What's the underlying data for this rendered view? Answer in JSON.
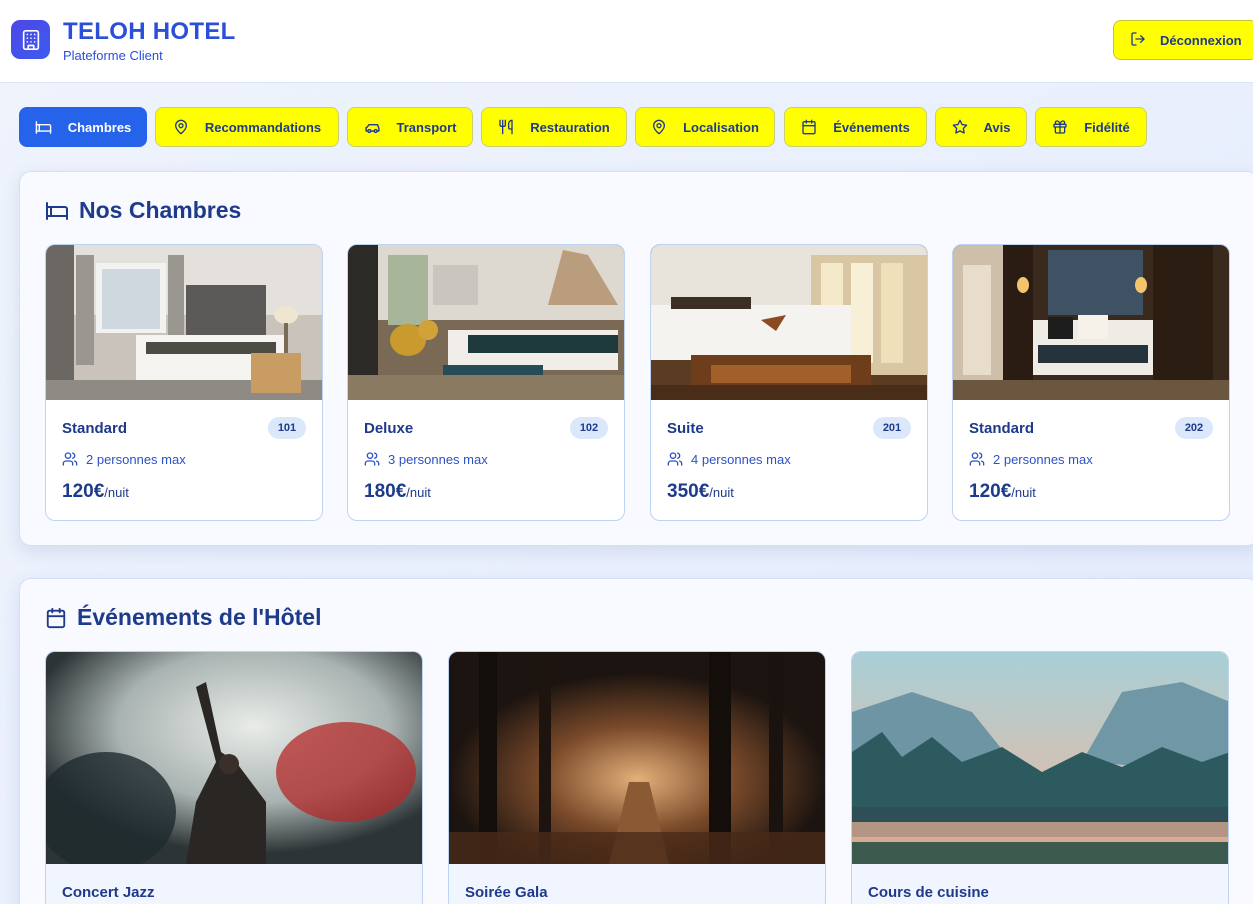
{
  "header": {
    "title": "TELOH HOTEL",
    "subtitle": "Plateforme Client",
    "logo_icon": "building-icon",
    "logout_label": "Déconnexion",
    "logout_icon": "logout-icon"
  },
  "tabs": [
    {
      "label": "Chambres",
      "icon": "bed-icon",
      "active": true
    },
    {
      "label": "Recommandations",
      "icon": "map-pin-icon",
      "active": false
    },
    {
      "label": "Transport",
      "icon": "car-icon",
      "active": false
    },
    {
      "label": "Restauration",
      "icon": "utensils-icon",
      "active": false
    },
    {
      "label": "Localisation",
      "icon": "map-pin-icon",
      "active": false
    },
    {
      "label": "Événements",
      "icon": "calendar-icon",
      "active": false
    },
    {
      "label": "Avis",
      "icon": "star-icon",
      "active": false
    },
    {
      "label": "Fidélité",
      "icon": "gift-icon",
      "active": false
    }
  ],
  "rooms_section": {
    "title": "Nos Chambres",
    "icon": "bed-icon",
    "rooms": [
      {
        "name": "Standard",
        "number": "101",
        "capacity": "2 personnes max",
        "price": "120€",
        "unit": "/nuit"
      },
      {
        "name": "Deluxe",
        "number": "102",
        "capacity": "3 personnes max",
        "price": "180€",
        "unit": "/nuit"
      },
      {
        "name": "Suite",
        "number": "201",
        "capacity": "4 personnes max",
        "price": "350€",
        "unit": "/nuit"
      },
      {
        "name": "Standard",
        "number": "202",
        "capacity": "2 personnes max",
        "price": "120€",
        "unit": "/nuit"
      }
    ]
  },
  "events_section": {
    "title": "Événements de l'Hôtel",
    "icon": "calendar-icon",
    "events": [
      {
        "name": "Concert Jazz"
      },
      {
        "name": "Soirée Gala"
      },
      {
        "name": "Cours de cuisine"
      }
    ]
  },
  "colors": {
    "accent_yellow": "#ffff00",
    "active_blue": "#2563eb",
    "brand_blue": "#2b4fd8",
    "text_navy": "#1e3a8a"
  }
}
